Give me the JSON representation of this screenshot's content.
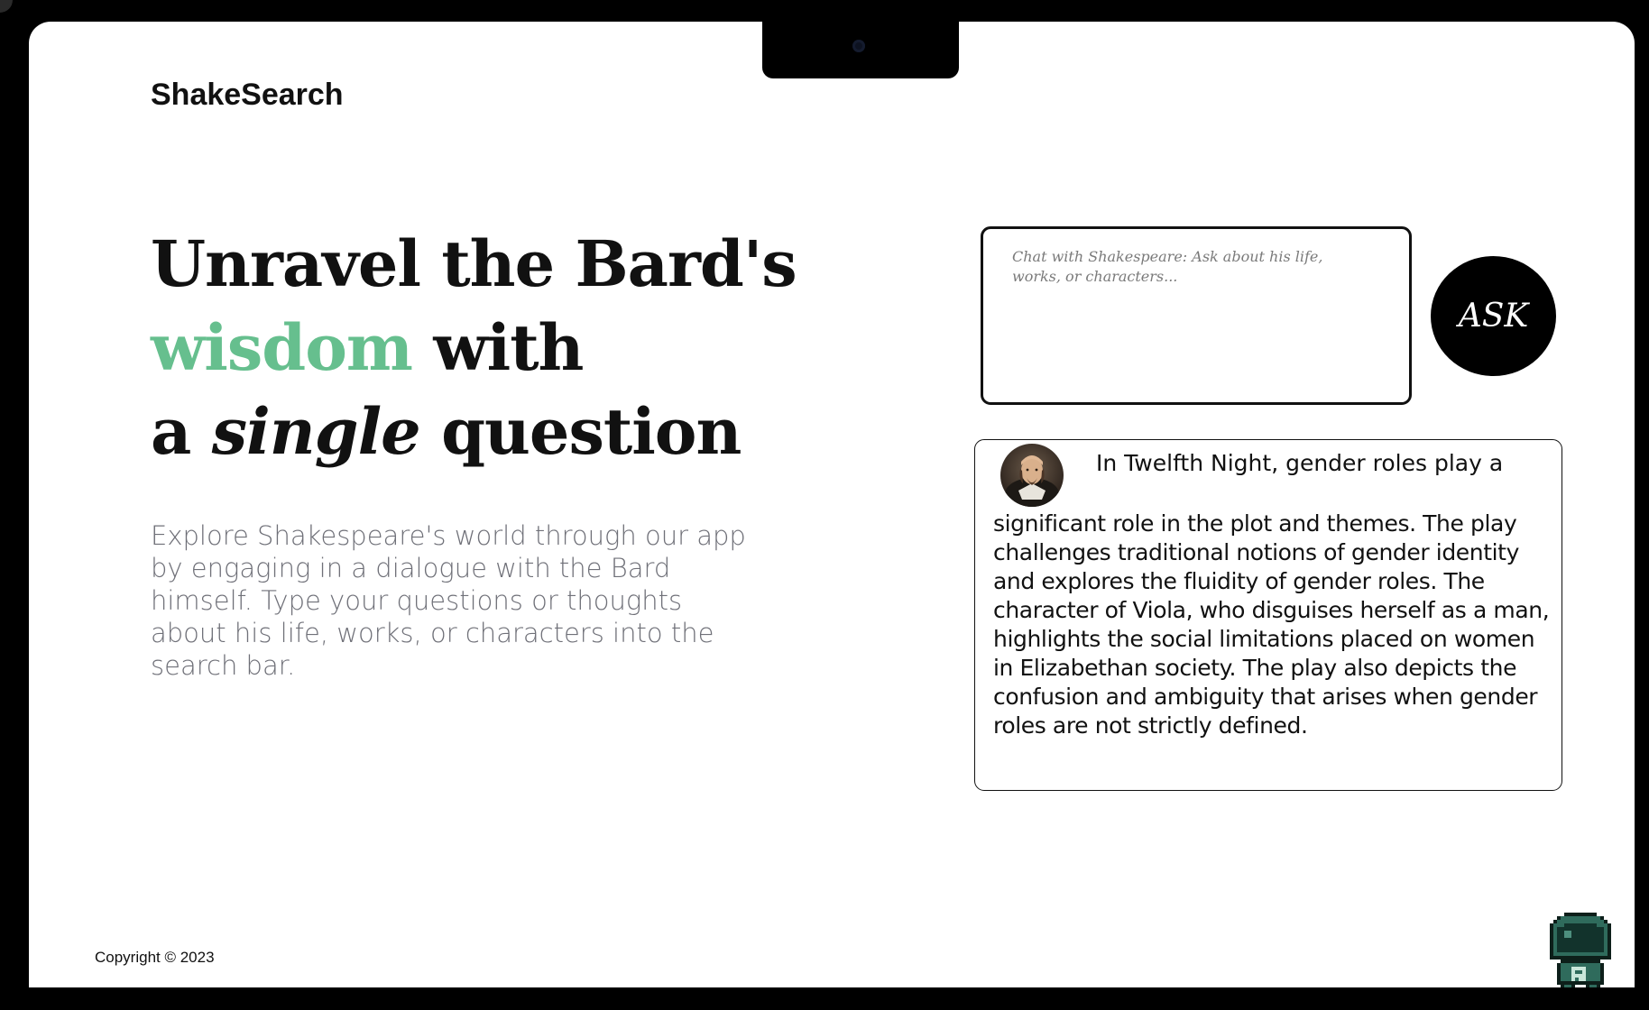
{
  "brand": {
    "name": "ShakeSearch"
  },
  "hero": {
    "line1": "Unravel the Bard's",
    "line2_accent": "wisdom",
    "line2_rest": " with",
    "line3_pre": "a ",
    "line3_italic": "single",
    "line3_rest": " question",
    "accent_color": "#66bf8e",
    "intro": "Explore Shakespeare's world through our app by engaging in a dialogue with the Bard himself. Type your questions or thoughts about his life, works, or characters into the search bar."
  },
  "search": {
    "placeholder": "Chat with Shakespeare: Ask about his life, works, or characters...",
    "value": "",
    "button_label": "ASK"
  },
  "answer": {
    "avatar_icon": "shakespeare-portrait-icon",
    "first_line": "In Twelfth Night, gender roles play a",
    "rest": "significant role in the plot and themes. The play challenges traditional notions of gender identity and explores the fluidity of gender roles. The character of Viola, who disguises herself as a man, highlights the social limitations placed on women in Elizabethan society. The play also depicts the confusion and ambiguity that arises when gender roles are not strictly defined."
  },
  "footer": {
    "copyright": "Copyright © 2023",
    "mascot_icon": "pixel-astronaut-icon"
  }
}
